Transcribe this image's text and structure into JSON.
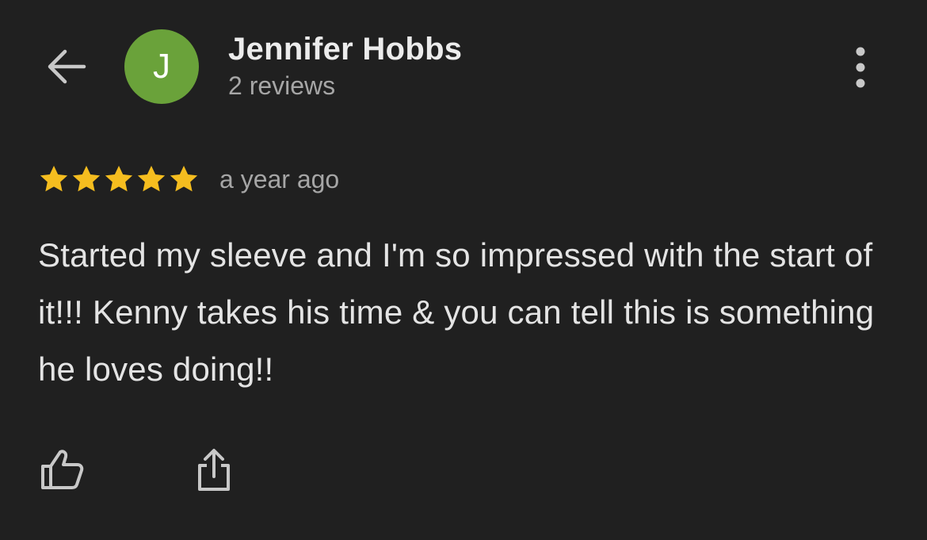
{
  "header": {
    "back_icon": "arrow-left-icon",
    "more_icon": "more-vertical-icon"
  },
  "author": {
    "initial": "J",
    "name": "Jennifer Hobbs",
    "meta": "2 reviews",
    "avatar_color": "#6aa23a"
  },
  "review": {
    "rating": 5,
    "max_rating": 5,
    "star_color": "#f5bd1f",
    "time_ago": "a year ago",
    "text": "Started my sleeve and I'm so impressed with the start of it!!! Kenny takes his time & you can tell this is something he loves doing!!"
  },
  "actions": {
    "like_icon": "thumbs-up-icon",
    "share_icon": "share-icon"
  },
  "colors": {
    "background": "#202020",
    "primary_text": "#ececec",
    "secondary_text": "#a6a6a6",
    "icon": "#c8c8c8"
  }
}
